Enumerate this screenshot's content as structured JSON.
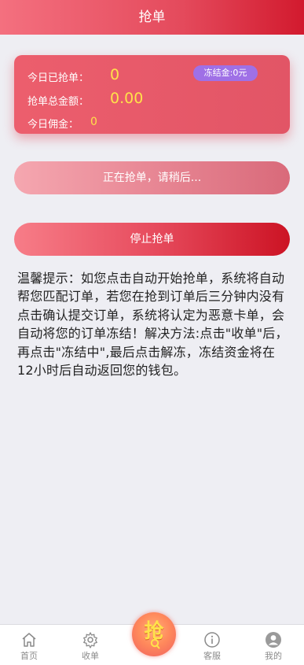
{
  "header": {
    "title": "抢单"
  },
  "stats": {
    "today_grab_label": "今日已抢单：",
    "today_grab_value": "0",
    "total_amount_label": "抢单总金额：",
    "total_amount_value": "0.00",
    "today_commission_label": "今日佣金：",
    "today_commission_value": "0",
    "frozen_badge": "冻结金:0元"
  },
  "buttons": {
    "grabbing_label": "正在抢单，请稍后...",
    "stop_label": "停止抢单"
  },
  "tip": {
    "text": "温馨提示：如您点击自动开始抢单，系统将自动帮您匹配订单，若您在抢到订单后三分钟内没有点击确认提交订单，系统将认定为恶意卡单，会自动将您的订单冻结！解决方法:点击\"收单\"后，再点击\"冻结中\",最后点击解冻，冻结资金将在12小时后自动返回您的钱包。"
  },
  "tabbar": {
    "items": [
      {
        "label": "首页",
        "icon": "home-icon"
      },
      {
        "label": "收单",
        "icon": "gear-icon"
      },
      {
        "label": "抢",
        "icon": "grab-icon"
      },
      {
        "label": "客服",
        "icon": "info-icon"
      },
      {
        "label": "我的",
        "icon": "user-icon"
      }
    ]
  },
  "colors": {
    "accent": "#e44a5c",
    "stop_red": "#cc1324",
    "badge": "#9f70e6",
    "value_yellow": "#ffe14a"
  }
}
